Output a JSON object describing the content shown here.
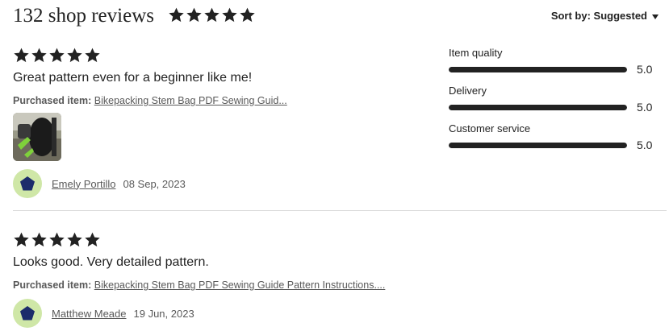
{
  "header": {
    "title": "132 shop reviews",
    "stars": 5,
    "sort_label": "Sort by: Suggested"
  },
  "ratings": [
    {
      "label": "Item quality",
      "value": "5.0",
      "fraction": 1.0
    },
    {
      "label": "Delivery",
      "value": "5.0",
      "fraction": 1.0
    },
    {
      "label": "Customer service",
      "value": "5.0",
      "fraction": 1.0
    }
  ],
  "reviews": [
    {
      "stars": 5,
      "text": "Great pattern even for a beginner like me!",
      "purchased_label": "Purchased item:",
      "item": "Bikepacking Stem Bag PDF Sewing Guid...",
      "author": "Emely Portillo",
      "date": "08 Sep, 2023"
    },
    {
      "stars": 5,
      "text": "Looks good. Very detailed pattern.",
      "purchased_label": "Purchased item:",
      "item": "Bikepacking Stem Bag PDF Sewing Guide Pattern Instructions....",
      "author": "Matthew Meade",
      "date": "19 Jun, 2023"
    }
  ],
  "colors": {
    "text": "#222222",
    "muted": "#595959",
    "avatar_bg": "#cfe7a7",
    "avatar_shape": "#1c2c6b",
    "bar_fill": "#222222",
    "divider": "#d9d9d9"
  },
  "icons": {
    "star": "star-icon",
    "caret": "caret-down-icon",
    "avatar": "pentagon-avatar-icon"
  }
}
